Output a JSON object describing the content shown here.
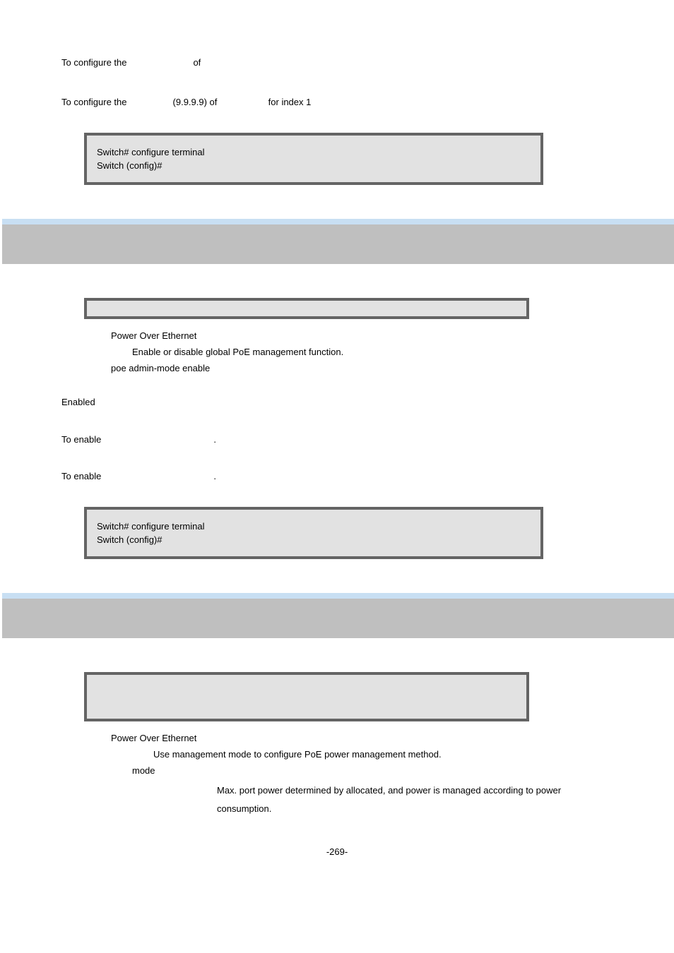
{
  "top": {
    "usage1_pre": "To configure the",
    "usage1_mid": "of",
    "usage2_pre": "To configure the",
    "usage2_ip": "(9.9.9.9) of",
    "usage2_post": "for index 1"
  },
  "codebox1": {
    "line1": "Switch# configure terminal",
    "line2": "Switch (config)#"
  },
  "section_admin": {
    "syntax": "",
    "group_label": "Power Over Ethernet",
    "desc": "Enable or disable global PoE management function.",
    "syntax_text": "poe admin-mode enable",
    "default": "Enabled",
    "usage1": "To enable",
    "usage1_post": ".",
    "usage2": "To enable",
    "usage2_post": "."
  },
  "codebox2": {
    "line1": "Switch# configure terminal",
    "line2": "Switch (config)#"
  },
  "section_mgmt": {
    "syntax": "",
    "group_label": "Power Over Ethernet",
    "desc": "Use management mode to configure PoE power management method.",
    "mode_label": "mode",
    "mode_desc": "Max. port power determined by allocated, and power is managed according to power consumption."
  },
  "page_number": "-269-"
}
